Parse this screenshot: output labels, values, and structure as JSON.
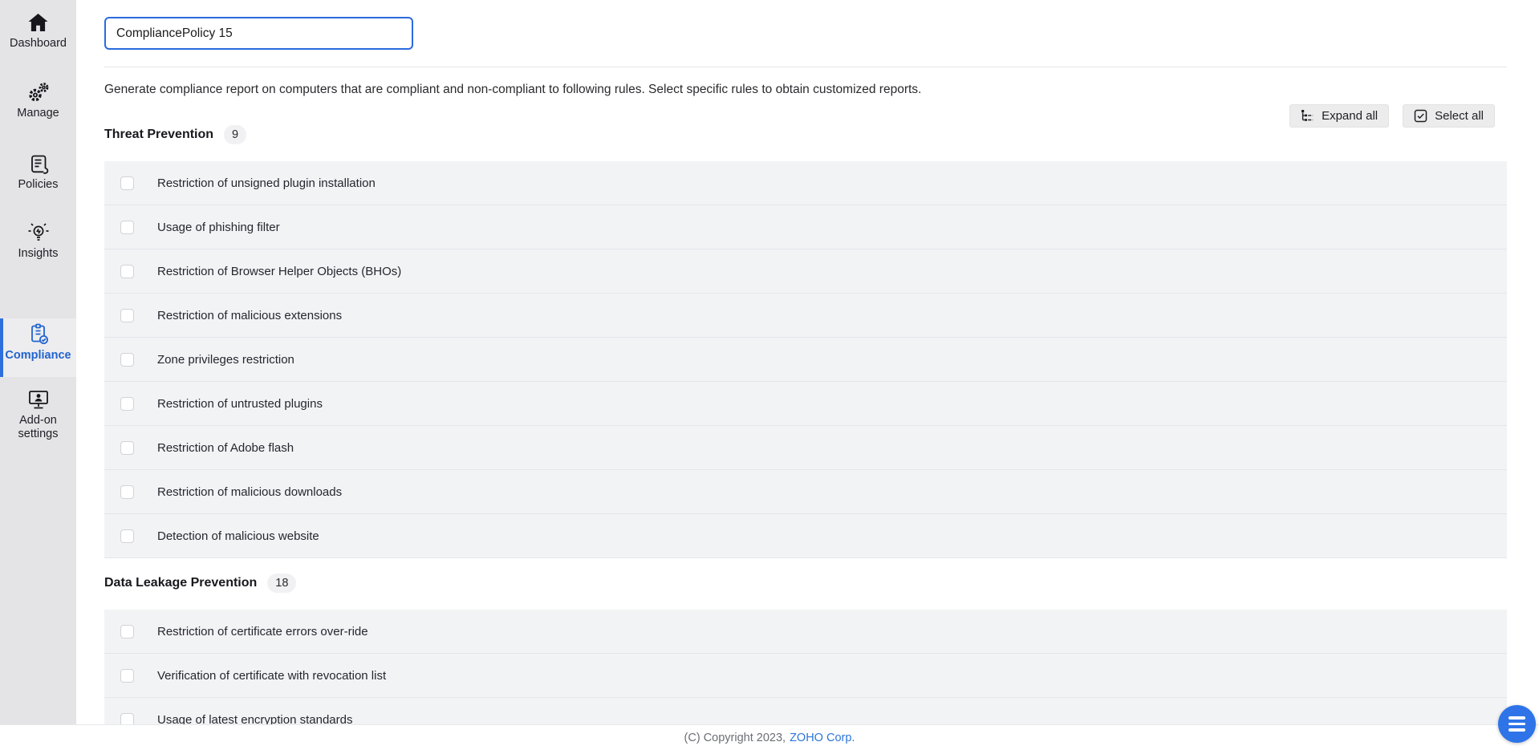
{
  "sidebar": {
    "items": [
      {
        "label": "Dashboard",
        "icon": "home-icon",
        "active": false
      },
      {
        "label": "Manage",
        "icon": "gears-icon",
        "active": false
      },
      {
        "label": "Policies",
        "icon": "scroll-icon",
        "active": false
      },
      {
        "label": "Insights",
        "icon": "lightbulb-icon",
        "active": false
      },
      {
        "label": "Compliance",
        "icon": "clipboard-check-icon",
        "active": true
      },
      {
        "label": "Add-on settings",
        "icon": "monitor-share-icon",
        "active": false
      }
    ],
    "active_color": "#2163cf",
    "background_color": "#e4e4e6"
  },
  "header": {
    "policy_name_value": "CompliancePolicy 15",
    "description": "Generate compliance report on computers that are compliant and non-compliant to following rules. Select specific rules to obtain customized reports."
  },
  "toolbar": {
    "expand_all_label": "Expand all",
    "select_all_label": "Select all"
  },
  "sections": [
    {
      "title": "Threat Prevention",
      "count": "9",
      "rules": [
        "Restriction of unsigned plugin installation",
        "Usage of phishing filter",
        "Restriction of Browser Helper Objects (BHOs)",
        "Restriction of malicious extensions",
        "Zone privileges restriction",
        "Restriction of untrusted plugins",
        "Restriction of Adobe flash",
        "Restriction of malicious downloads",
        "Detection of malicious website"
      ]
    },
    {
      "title": "Data Leakage Prevention",
      "count": "18",
      "rules": [
        "Restriction of certificate errors over-ride",
        "Verification of certificate with revocation list",
        "Usage of latest encryption standards"
      ]
    }
  ],
  "footer": {
    "copyright_text": "(C) Copyright 2023,",
    "link_text": "ZOHO Corp."
  },
  "fab": {
    "icon": "hamburger-menu-icon",
    "color": "#2e74e8"
  },
  "colors": {
    "input_focus_border": "#2a6add",
    "row_background": "#f2f3f5",
    "link_blue": "#2d75d9"
  }
}
